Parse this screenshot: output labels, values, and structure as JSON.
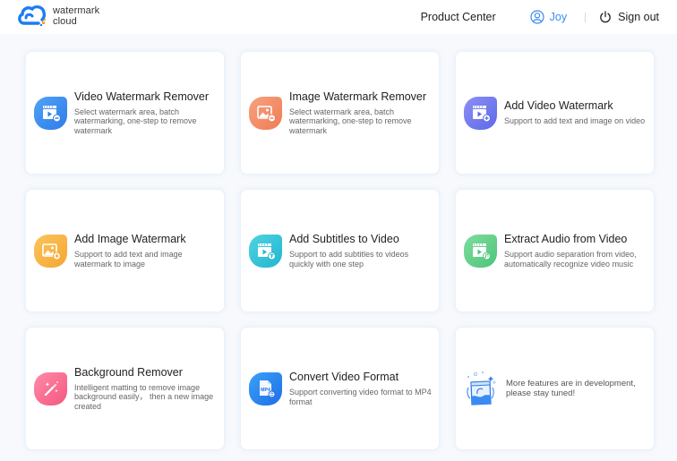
{
  "header": {
    "logo_icon": "cloud-logo-icon",
    "logo_line1": "watermark",
    "logo_line2": "cloud",
    "product_center": "Product Center",
    "user_icon": "user-circle-icon",
    "username": "Joy",
    "signout_icon": "power-icon",
    "signout_label": "Sign out"
  },
  "colors": {
    "accent": "#3a8bf5",
    "background": "#f7f9fc",
    "card": "#ffffff"
  },
  "cards": [
    {
      "title": "Video Watermark Remover",
      "desc": "Select watermark area, batch watermarking, one-step to remove watermark",
      "icon": "video-remove-icon",
      "color_from": "#4fa3f7",
      "color_to": "#2f7ce8"
    },
    {
      "title": "Image Watermark Remover",
      "desc": "Select watermark area, batch watermarking, one-step to remove watermark",
      "icon": "image-remove-icon",
      "color_from": "#f7a27e",
      "color_to": "#ee7c56"
    },
    {
      "title": "Add Video Watermark",
      "desc": "Support to add text and image on video",
      "icon": "video-add-icon",
      "color_from": "#8c8ff5",
      "color_to": "#5e69e8"
    },
    {
      "title": "Add Image Watermark",
      "desc": "Support to add text and image watermark to image",
      "icon": "image-add-icon",
      "color_from": "#fbc55c",
      "color_to": "#f4a632"
    },
    {
      "title": "Add Subtitles to Video",
      "desc": "Support to add subtitles to videos quickly with one step",
      "icon": "video-subtitle-icon",
      "color_from": "#4fd3e3",
      "color_to": "#22b6cf"
    },
    {
      "title": "Extract Audio from Video",
      "desc": "Support audio separation from video, automatically recognize video music",
      "icon": "video-audio-icon",
      "color_from": "#7fdc9c",
      "color_to": "#4cc57a"
    },
    {
      "title": "Background Remover",
      "desc": "Intelligent matting to remove image background easily， then a new image created",
      "icon": "magic-wand-icon",
      "color_from": "#ff8aa8",
      "color_to": "#f5577f"
    },
    {
      "title": "Convert Video Format",
      "desc": "Support converting video format to MP4 format",
      "icon": "mp4-file-icon",
      "color_from": "#3aa0f7",
      "color_to": "#1f6fe6",
      "badge": "MP4"
    }
  ],
  "more": {
    "icon": "in-development-illustration",
    "text": "More features are in development, please stay tuned!"
  }
}
